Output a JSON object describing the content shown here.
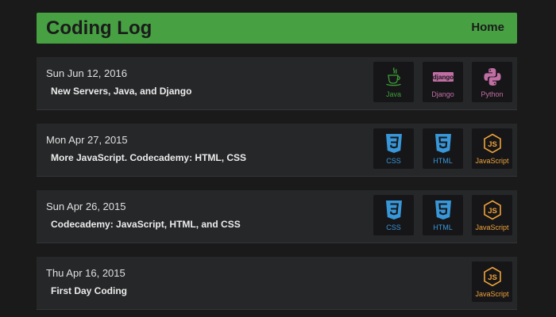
{
  "header": {
    "title": "Coding Log",
    "home_label": "Home"
  },
  "colors": {
    "header_bg": "#47a143",
    "java": "#3f9d39",
    "django": "#c16ea4",
    "python": "#c16ea4",
    "css": "#3897d9",
    "html": "#3897d9",
    "javascript": "#f0a33a"
  },
  "entries": [
    {
      "date": "Sun Jun 12, 2016",
      "title": "New Servers, Java, and Django",
      "badges": [
        {
          "label": "Java",
          "icon": "java-cup-icon"
        },
        {
          "label": "Django",
          "icon": "django-logo-icon"
        },
        {
          "label": "Python",
          "icon": "python-logo-icon"
        }
      ]
    },
    {
      "date": "Mon Apr 27, 2015",
      "title": "More JavaScript. Codecademy: HTML, CSS",
      "badges": [
        {
          "label": "CSS",
          "icon": "css3-shield-icon"
        },
        {
          "label": "HTML",
          "icon": "html5-shield-icon"
        },
        {
          "label": "JavaScript",
          "icon": "js-hexagon-icon"
        }
      ]
    },
    {
      "date": "Sun Apr 26, 2015",
      "title": "Codecademy: JavaScript, HTML, and CSS",
      "badges": [
        {
          "label": "CSS",
          "icon": "css3-shield-icon"
        },
        {
          "label": "HTML",
          "icon": "html5-shield-icon"
        },
        {
          "label": "JavaScript",
          "icon": "js-hexagon-icon"
        }
      ]
    },
    {
      "date": "Thu Apr 16, 2015",
      "title": "First Day Coding",
      "badges": [
        {
          "label": "JavaScript",
          "icon": "js-hexagon-icon"
        }
      ]
    }
  ]
}
